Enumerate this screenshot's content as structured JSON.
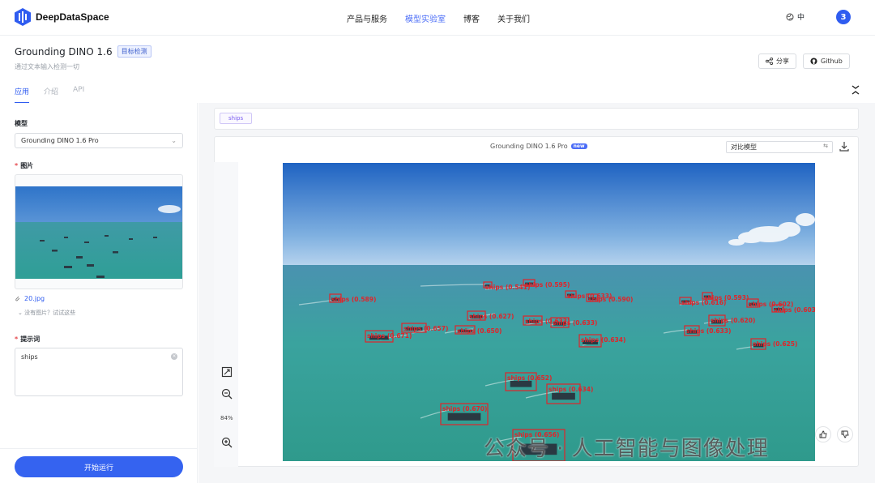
{
  "brand": {
    "name": "DeepDataSpace",
    "accent": "#2f5cf0"
  },
  "nav": {
    "items": [
      "产品与服务",
      "模型实验室",
      "博客",
      "关于我们"
    ],
    "active_index": 1
  },
  "lang": {
    "label": "中",
    "icon": "globe-icon"
  },
  "user": {
    "avatar_text": "3"
  },
  "header": {
    "title": "Grounding DINO 1.6",
    "tag": "目标检测",
    "subtitle": "通过文本输入检测一切",
    "share_label": "分享",
    "github_label": "Github"
  },
  "tabs": {
    "items": [
      "应用",
      "介绍",
      "API"
    ],
    "active_index": 0
  },
  "form": {
    "model_label": "模型",
    "model_value": "Grounding DINO 1.6 Pro",
    "image_label": "图片",
    "file_name": "20.jpg",
    "try_text": "没有图片？试试这些",
    "prompt_label": "提示词",
    "prompt_value": "ships",
    "run_label": "开始运行"
  },
  "result": {
    "chip": "ships",
    "model_title": "Grounding DINO 1.6 Pro",
    "new_badge": "new",
    "compare_placeholder": "对比模型",
    "zoom": "84%",
    "detections": [
      {
        "label": "ships (0.589)"
      },
      {
        "label": "ships (0.541)"
      },
      {
        "label": "ships (0.595)"
      },
      {
        "label": "ships (0.633)"
      },
      {
        "label": "ships (0.590)"
      },
      {
        "label": "ships (0.627)"
      },
      {
        "label": "ships (0.657)"
      },
      {
        "label": "ships (0.650)"
      },
      {
        "label": "ships (0.671)"
      },
      {
        "label": "ships (0.633)"
      },
      {
        "label": "ships (0.634)"
      },
      {
        "label": "ships (0.633)"
      },
      {
        "label": "ships (0.593)"
      },
      {
        "label": "ships (0.616)"
      },
      {
        "label": "ships (0.602)"
      },
      {
        "label": "ships (0.603)"
      },
      {
        "label": "ships (0.620)"
      },
      {
        "label": "ships (0.633)"
      },
      {
        "label": "ships (0.625)"
      },
      {
        "label": "ships (0.652)"
      },
      {
        "label": "ships (0.634)"
      },
      {
        "label": "ships (0.670)"
      },
      {
        "label": "ships (0.656)"
      }
    ]
  },
  "watermark": "公众号 · 人工智能与图像处理"
}
